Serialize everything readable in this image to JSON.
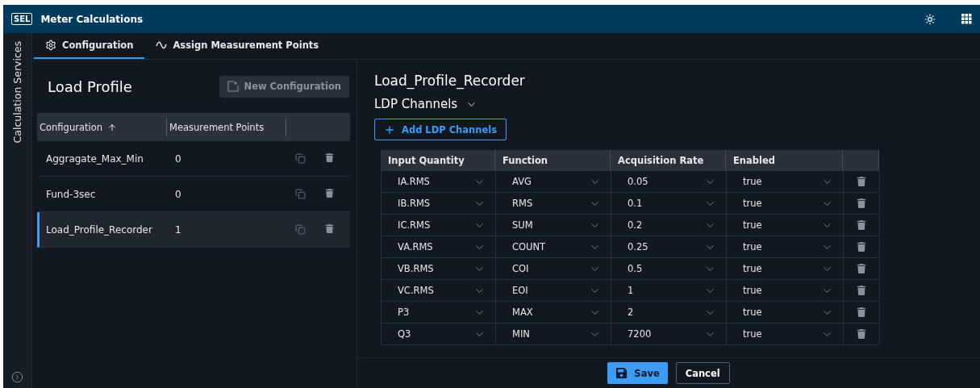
{
  "app": {
    "logo": "SEL",
    "title": "Meter Calculations"
  },
  "side_rail": {
    "label": "Calculation Services"
  },
  "tabs": [
    {
      "label": "Configuration",
      "selected": true,
      "kind": "gear"
    },
    {
      "label": "Assign Measurement Points",
      "selected": false,
      "kind": "wave"
    }
  ],
  "left": {
    "title": "Load Profile",
    "new_button": {
      "label": "New Configuration",
      "disabled": true
    },
    "columns": [
      "Configuration",
      "Measurement Points"
    ],
    "rows": [
      {
        "name": "Aggragate_Max_Min",
        "points": "0",
        "selected": false
      },
      {
        "name": "Fund-3sec",
        "points": "0",
        "selected": false
      },
      {
        "name": "Load_Profile_Recorder",
        "points": "1",
        "selected": true
      }
    ]
  },
  "right": {
    "title": "Load_Profile_Recorder",
    "section": {
      "label": "LDP Channels",
      "expanded": true
    },
    "add_button": "Add LDP Channels",
    "columns": [
      "Input Quantity",
      "Function",
      "Acquisition Rate",
      "Enabled"
    ],
    "rows": [
      {
        "input": "IA.RMS",
        "function": "AVG",
        "rate": "0.05",
        "enabled": "true"
      },
      {
        "input": "IB.RMS",
        "function": "RMS",
        "rate": "0.1",
        "enabled": "true"
      },
      {
        "input": "IC.RMS",
        "function": "SUM",
        "rate": "0.2",
        "enabled": "true"
      },
      {
        "input": "VA.RMS",
        "function": "COUNT",
        "rate": "0.25",
        "enabled": "true"
      },
      {
        "input": "VB.RMS",
        "function": "COI",
        "rate": "0.5",
        "enabled": "true"
      },
      {
        "input": "VC.RMS",
        "function": "EOI",
        "rate": "1",
        "enabled": "true"
      },
      {
        "input": "P3",
        "function": "MAX",
        "rate": "2",
        "enabled": "true"
      },
      {
        "input": "Q3",
        "function": "MIN",
        "rate": "7200",
        "enabled": "true"
      }
    ]
  },
  "footer": {
    "save": "Save",
    "cancel": "Cancel"
  }
}
